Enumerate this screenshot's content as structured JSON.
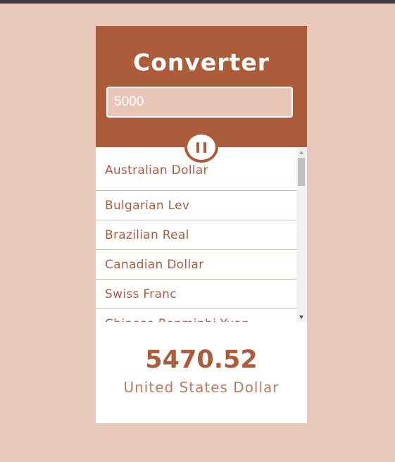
{
  "converter": {
    "title": "Converter",
    "amount_value": "5000",
    "toggle_icon": "pause-icon",
    "currencies": [
      "Australian Dollar",
      "Bulgarian Lev",
      "Brazilian Real",
      "Canadian Dollar",
      "Swiss Franc",
      "Chinese Renminbi Yuan"
    ],
    "result_value": "5470.52",
    "result_currency": "United States Dollar"
  },
  "colors": {
    "background": "#e8c8ba",
    "accent": "#ad5c3b",
    "input_fill": "#e9c6b7",
    "card": "#ffffff"
  }
}
